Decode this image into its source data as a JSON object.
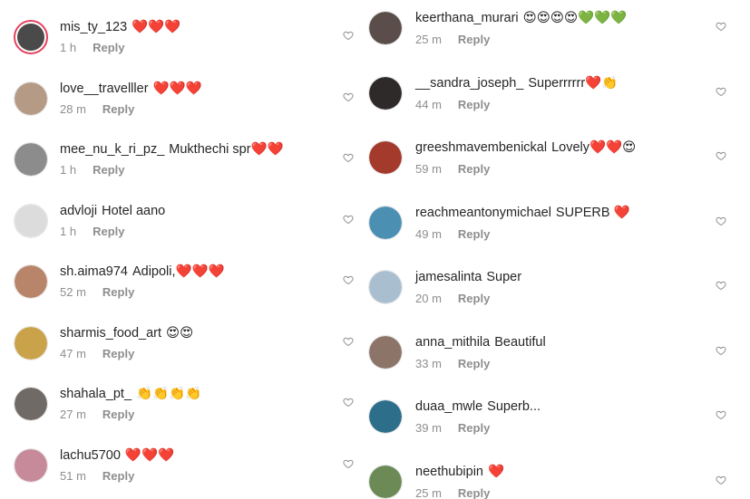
{
  "left": [
    {
      "user": "mis_ty_123",
      "text": "❤️❤️❤️",
      "time": "1 h",
      "reply": "Reply",
      "avatar_color": "#4a4a4a",
      "story_ring": true
    },
    {
      "user": "love__travelller",
      "text": "❤️❤️❤️",
      "time": "28 m",
      "reply": "Reply",
      "avatar_color": "#b59a86",
      "story_ring": false
    },
    {
      "user": "mee_nu_k_ri_pz_",
      "text": "Mukthechi spr❤️❤️",
      "time": "1 h",
      "reply": "Reply",
      "avatar_color": "#8c8c8c",
      "story_ring": false
    },
    {
      "user": "advloji",
      "text": "Hotel aano",
      "time": "1 h",
      "reply": "Reply",
      "avatar_color": "#dcdcdc",
      "story_ring": false
    },
    {
      "user": "sh.aima974",
      "text": "Adipoli,❤️❤️❤️",
      "time": "52 m",
      "reply": "Reply",
      "avatar_color": "#b8856b",
      "story_ring": false
    },
    {
      "user": "sharmis_food_art",
      "text": "😍😍",
      "time": "47 m",
      "reply": "Reply",
      "avatar_color": "#c9a24a",
      "story_ring": false
    },
    {
      "user": "shahala_pt_",
      "text": "👏👏👏👏",
      "time": "27 m",
      "reply": "Reply",
      "avatar_color": "#6f6a66",
      "story_ring": false
    },
    {
      "user": "lachu5700",
      "text": "❤️❤️❤️",
      "time": "51 m",
      "reply": "Reply",
      "avatar_color": "#c78a9a",
      "story_ring": false
    }
  ],
  "right": [
    {
      "user": "keerthana_murari",
      "text": "😍😍😍😍💚💚💚",
      "time": "25 m",
      "reply": "Reply",
      "avatar_color": "#5a4d4a"
    },
    {
      "user": "__sandra_joseph_",
      "text": "Superrrrrr❤️👏",
      "time": "44 m",
      "reply": "Reply",
      "avatar_color": "#2e2a2a"
    },
    {
      "user": "greeshmavembenickal",
      "text": "Lovely❤️❤️😍",
      "time": "59 m",
      "reply": "Reply",
      "avatar_color": "#a33a2c"
    },
    {
      "user": "reachmeantonymichael",
      "text": "SUPERB ❤️",
      "time": "49 m",
      "reply": "Reply",
      "avatar_color": "#4b8fb3"
    },
    {
      "user": "jamesalinta",
      "text": "Super",
      "time": "20 m",
      "reply": "Reply",
      "avatar_color": "#a9bfd0"
    },
    {
      "user": "anna_mithila",
      "text": "Beautiful",
      "time": "33 m",
      "reply": "Reply",
      "avatar_color": "#8c7468"
    },
    {
      "user": "duaa_mwle",
      "text": "Superb...",
      "time": "39 m",
      "reply": "Reply",
      "avatar_color": "#2d6e8a"
    },
    {
      "user": "neethubipin",
      "text": "❤️",
      "time": "25 m",
      "reply": "Reply",
      "avatar_color": "#6b8a55"
    }
  ]
}
